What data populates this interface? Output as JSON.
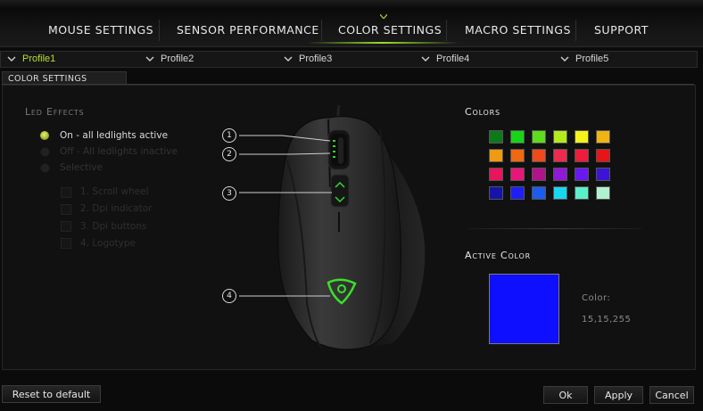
{
  "nav": {
    "tabs": [
      {
        "label": "MOUSE SETTINGS"
      },
      {
        "label": "SENSOR PERFORMANCE"
      },
      {
        "label": "COLOR SETTINGS",
        "active": true
      },
      {
        "label": "MACRO SETTINGS"
      },
      {
        "label": "SUPPORT"
      }
    ],
    "accent_color": "#9be028"
  },
  "profiles": [
    {
      "label": "Profile1",
      "active": true
    },
    {
      "label": "Profile2"
    },
    {
      "label": "Profile3"
    },
    {
      "label": "Profile4"
    },
    {
      "label": "Profile5"
    }
  ],
  "panel": {
    "tab_label": "COLOR SETTINGS"
  },
  "led_effects": {
    "title": "Led Effects",
    "options": [
      {
        "label": "On - all ledlights active",
        "selected": true
      },
      {
        "label": "Off - All ledlights inactive",
        "selected": false
      },
      {
        "label": "Selective",
        "selected": false
      }
    ],
    "selective_items": [
      {
        "label": "1. Scroll wheel"
      },
      {
        "label": "2. Dpi indicator"
      },
      {
        "label": "3. Dpi buttons"
      },
      {
        "label": "4. Logotype"
      }
    ]
  },
  "mouse_markers": [
    "1",
    "2",
    "3",
    "4"
  ],
  "colors": {
    "title": "Colors",
    "palette": [
      [
        "#0d7a1a",
        "#18d418",
        "#5cdc1c",
        "#b4ea1c",
        "#f4f21a",
        "#f0b414"
      ],
      [
        "#f09a12",
        "#f06810",
        "#f04a1c",
        "#f02a4c",
        "#f01c3c",
        "#e81416"
      ],
      [
        "#e8145c",
        "#e8167a",
        "#b01488",
        "#9018d8",
        "#6a18f0",
        "#3c14d8"
      ],
      [
        "#1414a8",
        "#1e1ef8",
        "#1c5cf0",
        "#18d8f0",
        "#5cf0c8",
        "#b0f0d0"
      ]
    ]
  },
  "active_color": {
    "title": "Active Color",
    "swatch_color": "#0f0fff",
    "label": "Color:",
    "value": "15,15,255"
  },
  "footer": {
    "reset_label": "Reset to default",
    "ok_label": "Ok",
    "apply_label": "Apply",
    "cancel_label": "Cancel"
  }
}
